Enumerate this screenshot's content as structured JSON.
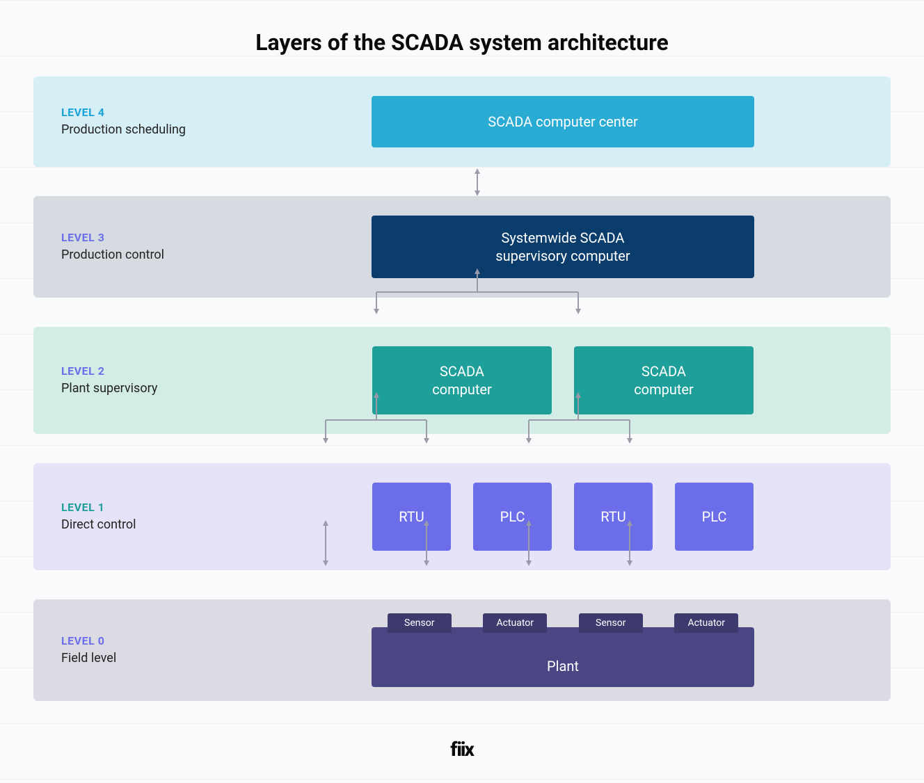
{
  "title": "Layers of the SCADA system architecture",
  "levels": {
    "l4": {
      "num": "LEVEL 4",
      "desc": "Production scheduling",
      "box": "SCADA computer center"
    },
    "l3": {
      "num": "LEVEL 3",
      "desc": "Production control",
      "box": "Systemwide SCADA supervisory computer"
    },
    "l2": {
      "num": "LEVEL 2",
      "desc": "Plant supervisory",
      "box_a": "SCADA computer",
      "box_b": "SCADA computer"
    },
    "l1": {
      "num": "LEVEL 1",
      "desc": "Direct control",
      "rtu": "RTU",
      "plc": "PLC"
    },
    "l0": {
      "num": "LEVEL 0",
      "desc": "Field level",
      "sensor": "Sensor",
      "actuator": "Actuator",
      "plant": "Plant"
    }
  },
  "brand": "fiix",
  "colors": {
    "l4_bg": "#d6eef6",
    "l4_box": "#29abd4",
    "l3_bg": "#d6dbe1",
    "l3_box": "#0a3d6b",
    "l2_bg": "#d3ece6",
    "l2_box": "#1f9f9a",
    "l1_bg": "#e5e3f7",
    "l1_box": "#6b6ee8",
    "l0_bg": "#dcdbe4",
    "l0_box": "#4a4684",
    "l0_tab": "#3d3a6e",
    "connector": "#9a9aa8"
  }
}
